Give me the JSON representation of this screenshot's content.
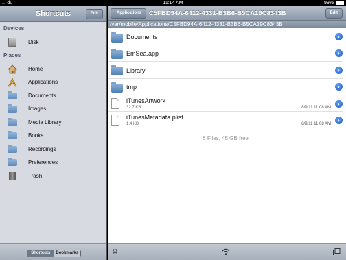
{
  "status_bar": {
    "carrier": "..l du",
    "time": "11:14 AM",
    "battery": "99%"
  },
  "sidebar": {
    "title": "Shortcuts",
    "edit_label": "Edit",
    "sections": {
      "devices": "Devices",
      "places": "Places"
    },
    "devices": [
      {
        "label": "Disk",
        "icon": "disk-icon"
      }
    ],
    "places": [
      {
        "label": "Home",
        "icon": "home-icon"
      },
      {
        "label": "Applications",
        "icon": "applications-icon"
      },
      {
        "label": "Documents",
        "icon": "folder-icon"
      },
      {
        "label": "Images",
        "icon": "folder-icon"
      },
      {
        "label": "Media Library",
        "icon": "folder-icon"
      },
      {
        "label": "Books",
        "icon": "folder-icon"
      },
      {
        "label": "Recordings",
        "icon": "folder-icon"
      },
      {
        "label": "Preferences",
        "icon": "folder-icon"
      },
      {
        "label": "Trash",
        "icon": "trash-icon"
      }
    ],
    "segmented": {
      "shortcuts": "Shortcuts",
      "bookmarks": "Bookmarks",
      "selected": "Shortcuts"
    }
  },
  "browser": {
    "back_label": "Applications",
    "title": "C5FBD94A-6412-4331-B3B6-B5CA19C8343B",
    "edit_label": "Edit",
    "path": "/var/mobile/Applications/C5FBD94A-6412-4331-B3B6-B5CA19C8343B",
    "items": [
      {
        "name": "Documents",
        "kind": "folder"
      },
      {
        "name": "EmSea.app",
        "kind": "folder"
      },
      {
        "name": "Library",
        "kind": "folder"
      },
      {
        "name": "tmp",
        "kind": "folder"
      },
      {
        "name": "iTunesArtwork",
        "kind": "file",
        "size": "32.7 KB",
        "date": "8/9/11 11:08 AM"
      },
      {
        "name": "iTunesMetadata.plist",
        "kind": "file",
        "size": "1.4 KB",
        "date": "8/9/11 11:08 AM"
      }
    ],
    "summary": "6 Files, 45 GB free"
  },
  "colors": {
    "accent": "#1d5ec2",
    "toolbar": "#8d9aab",
    "sidebar_bg": "#d7dbe1"
  }
}
